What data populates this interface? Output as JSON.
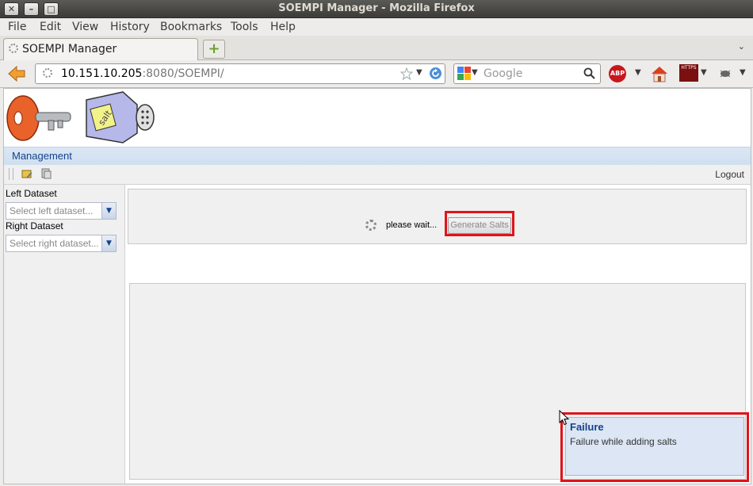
{
  "window": {
    "title": "SOEMPI Manager - Mozilla Firefox",
    "buttons": {
      "close": "✕",
      "minimize": "–",
      "maximize": "□"
    }
  },
  "menubar": {
    "items": [
      "File",
      "Edit",
      "View",
      "History",
      "Bookmarks",
      "Tools",
      "Help"
    ]
  },
  "tabs": {
    "active_label": "SOEMPI Manager",
    "new_tab_symbol": "+",
    "list_symbol": "⌄"
  },
  "navigation": {
    "url_host": "10.151.10.205",
    "url_rest": ":8080/SOEMPI/",
    "search_placeholder": "Google",
    "abp_label": "ABP",
    "https_label": "HTTPS"
  },
  "app": {
    "menu_label": "Management",
    "logout_label": "Logout",
    "left_dataset": {
      "label": "Left Dataset",
      "placeholder": "Select left dataset..."
    },
    "right_dataset": {
      "label": "Right Dataset",
      "placeholder": "Select right dataset..."
    },
    "wait_text": "please wait...",
    "generate_button": "Generate Salts",
    "notification": {
      "title": "Failure",
      "message": "Failure while adding salts"
    }
  },
  "colors": {
    "accent": "#15428b",
    "highlight_outline": "#e0141a",
    "notification_bg": "#dce6f4"
  },
  "icons": {
    "back": "back-arrow-icon",
    "reload": "reload-icon",
    "bookmark_star": "star-icon",
    "search": "magnifier-icon",
    "home": "home-icon",
    "key_logo": "key-logo",
    "salt_logo": "salt-shaker-logo"
  }
}
